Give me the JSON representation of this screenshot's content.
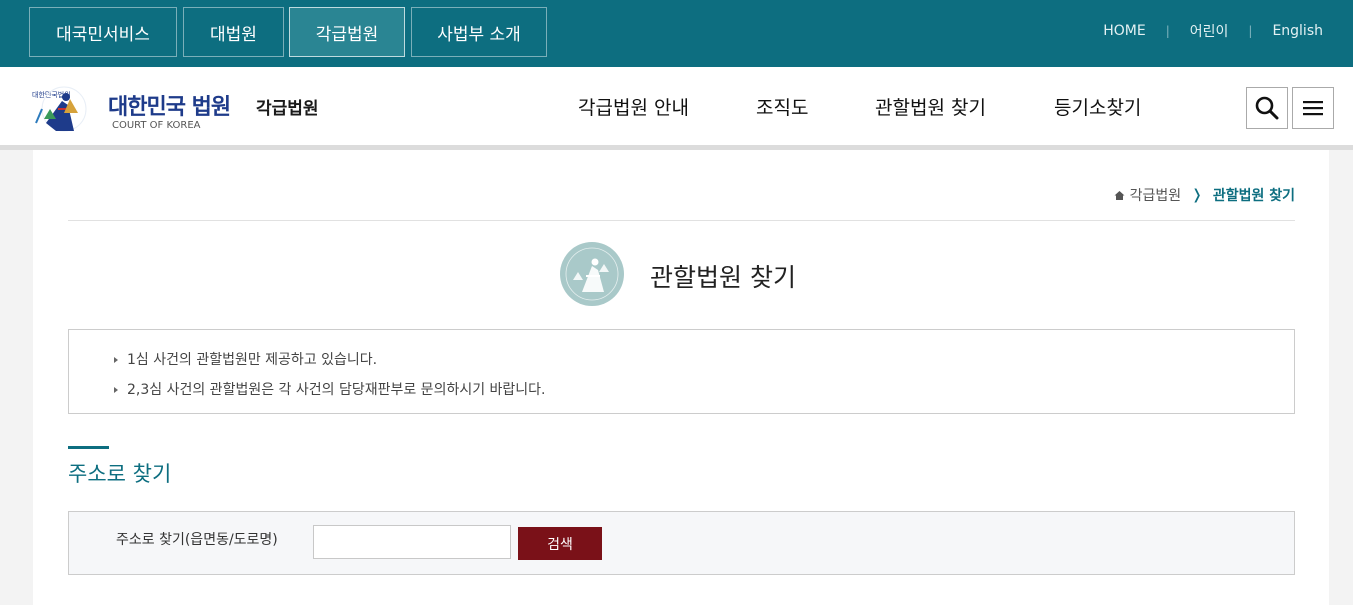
{
  "top_tabs": [
    {
      "label": "대국민서비스"
    },
    {
      "label": "대법원"
    },
    {
      "label": "각급법원"
    },
    {
      "label": "사법부 소개"
    }
  ],
  "top_links": {
    "home": "HOME",
    "kids": "어린이",
    "english": "English"
  },
  "logo": {
    "name_ko": "대한민국 법원",
    "sub": "각급법원",
    "name_en": "COURT OF KOREA",
    "seal_text": "대한민국법원"
  },
  "gnb": [
    {
      "label": "각급법원 안내"
    },
    {
      "label": "조직도"
    },
    {
      "label": "관할법원 찾기"
    },
    {
      "label": "등기소찾기"
    }
  ],
  "breadcrumb": {
    "parent": "각급법원",
    "current": "관할법원 찾기"
  },
  "page_title": "관할법원 찾기",
  "notices": [
    "1심 사건의 관할법원만 제공하고 있습니다.",
    "2,3심 사건의 관할법원은 각 사건의 담당재판부로 문의하시기 바랍니다."
  ],
  "section_title": "주소로 찾기",
  "search": {
    "label": "주소로 찾기(읍면동/도로명)",
    "value": "",
    "button": "검색"
  },
  "colors": {
    "brand": "#0d6e80",
    "active_tab": "#2a8593",
    "search_button": "#7a1118",
    "logo_text": "#1e3b8a"
  }
}
